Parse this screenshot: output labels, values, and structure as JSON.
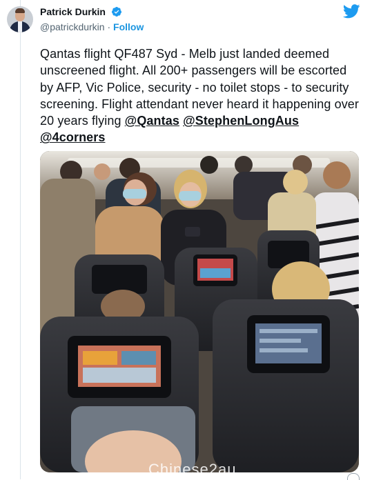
{
  "author": {
    "name": "Patrick Durkin",
    "handle": "@patrickdurkin",
    "separator": "·",
    "follow_label": "Follow"
  },
  "tweet": {
    "text": "Qantas flight QF487 Syd - Melb just landed deemed unscreened flight. All 200+ passengers will be escorted by AFP, Vic Police, security - no toilet stops - to security screening. Flight attendant never heard it happening over 20 years flying ",
    "mentions": [
      "@Qantas",
      "@StephenLongAus",
      "@4corners"
    ]
  },
  "watermark": "Chinese2au",
  "colors": {
    "link_blue": "#1b95e0",
    "handle_gray": "#536471",
    "text": "#0f1419",
    "verified_blue": "#1d9bf0",
    "twitter_blue": "#1d9bf0"
  },
  "icons": [
    "verified-badge-icon",
    "twitter-bird-icon"
  ]
}
